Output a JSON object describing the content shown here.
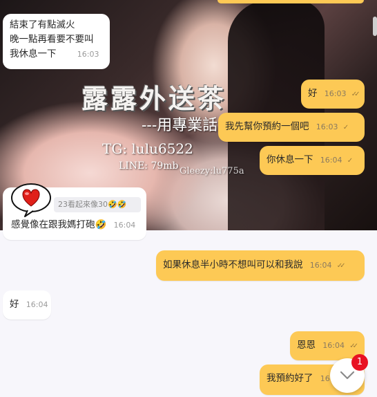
{
  "background": {
    "title": "露露外送茶",
    "subtitle": "---用專業話",
    "tg": "TG: lulu6522",
    "line": "LINE: 79mb",
    "gleezy": "Gleezy:lu775a"
  },
  "messages": [
    {
      "lines": [
        "結束了有點滅火",
        "晚一點再看要不要叫",
        "我休息一下"
      ],
      "time": "16:03",
      "side": "in"
    },
    {
      "text": "好",
      "time": "16:03",
      "side": "out",
      "read": true
    },
    {
      "text": "我先幫你預約一個吧",
      "time": "16:03",
      "side": "out",
      "read": false
    },
    {
      "text": "你休息一下",
      "time": "16:04",
      "side": "out",
      "read": false
    },
    {
      "reply": "23看起來像30🤣🤣",
      "text": "感覺像在跟我媽打砲🤣",
      "time": "16:04",
      "side": "in"
    },
    {
      "text": "如果休息半小時不想叫可以和我說",
      "time": "16:04",
      "side": "out",
      "read": true
    },
    {
      "text": "好",
      "time": "16:04",
      "side": "in"
    },
    {
      "text": "恩恩",
      "time": "16:04",
      "side": "out",
      "read": true
    },
    {
      "text": "我預約好了",
      "time": "16",
      "side": "out",
      "read": false
    }
  ],
  "scroll_button": {
    "icon": "chevron-down-icon",
    "unread_count": "1"
  },
  "colors": {
    "outgoing": "#fdc955",
    "incoming": "#ffffff",
    "badge": "#e81123"
  }
}
